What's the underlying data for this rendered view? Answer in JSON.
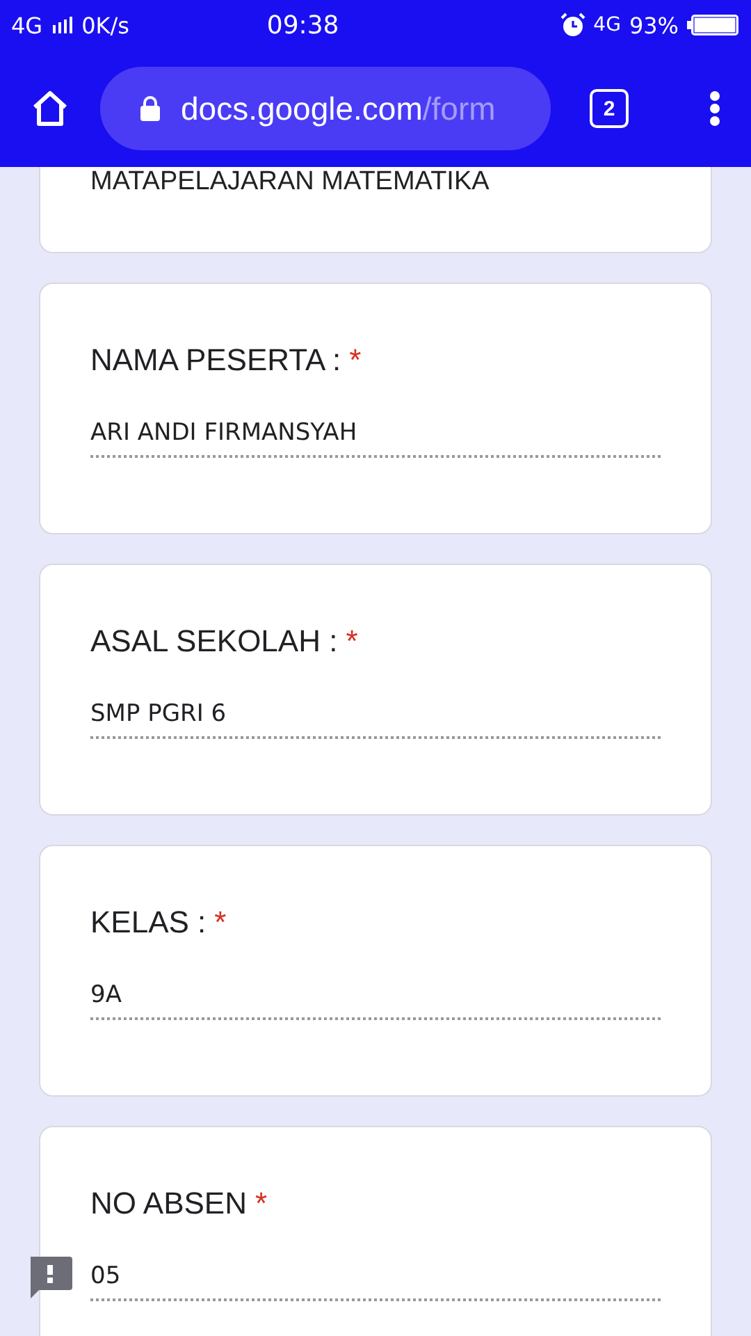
{
  "status_bar": {
    "network": "4G",
    "speed": "0K/s",
    "time": "09:38",
    "data_type": "4G",
    "battery": "93%"
  },
  "browser": {
    "url_host": "docs.google.com",
    "url_path": "/form",
    "tab_count": "2"
  },
  "intro": {
    "text": "MATAPELAJARAN MATEMATIKA"
  },
  "questions": [
    {
      "label": "NAMA PESERTA :",
      "required": true,
      "value": "ARI ANDI FIRMANSYAH"
    },
    {
      "label": "ASAL SEKOLAH :",
      "required": true,
      "value": "SMP PGRI 6"
    },
    {
      "label": "KELAS :",
      "required": true,
      "value": "9A"
    },
    {
      "label": "NO ABSEN",
      "required": true,
      "value": "05"
    }
  ],
  "required_mark": "*"
}
